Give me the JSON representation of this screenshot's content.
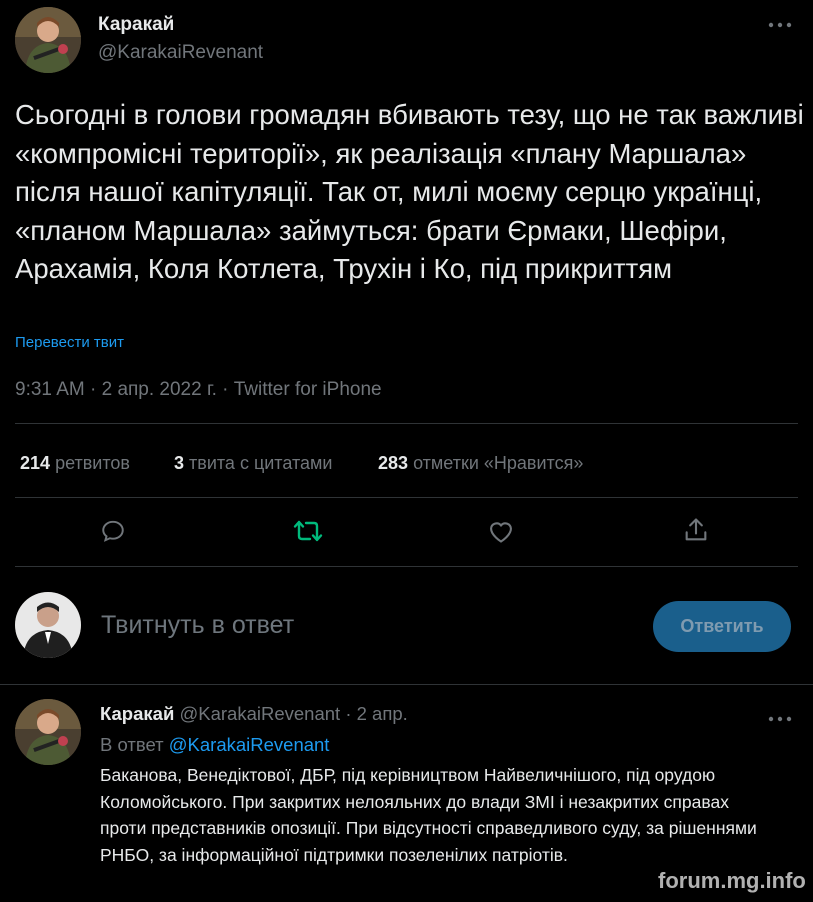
{
  "tweet": {
    "author_name": "Каракай",
    "author_handle": "@KarakaiRevenant",
    "more_icon": "more-dots-icon",
    "text": "Сьогодні в голови громадян вбивають тезу, що не так важливі «компромісні території», як реалізація «плану Маршала» після нашої капітуляції. Так от, милі моєму серцю українці, «планом Маршала» займуться: брати Єрмаки, Шефіри, Арахамія, Коля Котлета, Трухін і Ко, під прикриттям",
    "translate_label": "Перевести твит",
    "timestamp": "9:31 AM · 2 апр. 2022 г. · Twitter for iPhone",
    "stats": {
      "retweets_count": "214",
      "retweets_label": "ретвитов",
      "quotes_count": "3",
      "quotes_label": "твита с цитатами",
      "likes_count": "283",
      "likes_label": "отметки «Нравится»"
    }
  },
  "compose": {
    "placeholder": "Твитнуть в ответ",
    "button_label": "Ответить"
  },
  "reply": {
    "author_name": "Каракай",
    "author_handle": "@KarakaiRevenant",
    "date": "· 2 апр.",
    "in_reply_prefix": "В ответ",
    "in_reply_handle": "@KarakaiRevenant",
    "text": "Баканова, Венедіктової, ДБР, під керівництвом Найвеличнішого, під орудою Коломойського. При закритих нелояльних до влади ЗМІ і незакритих справах проти представників опозиції. При відсутності справедливого суду, за рішеннями РНБО, за інформаційної підтримки позеленілих патріотів."
  },
  "watermark": "forum.mg.info",
  "colors": {
    "background": "#000000",
    "text": "#e7e9ea",
    "muted": "#71767b",
    "link": "#1d9bf0",
    "retweet_green": "#00ba7c",
    "button_bg": "#1a5f8c"
  }
}
